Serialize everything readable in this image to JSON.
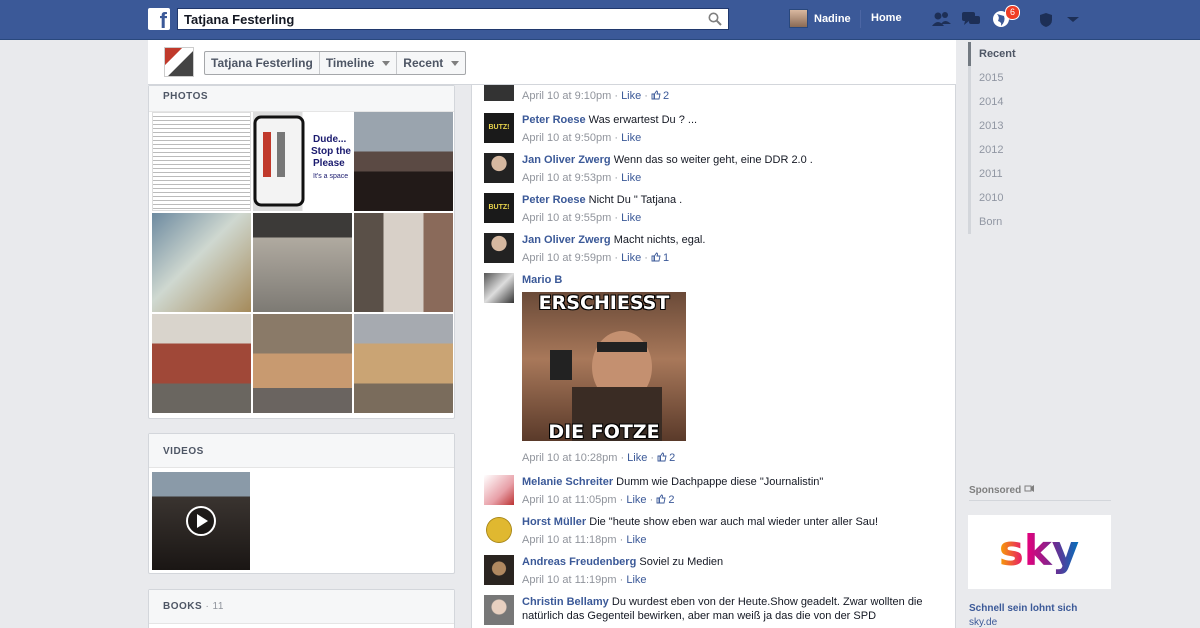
{
  "header": {
    "logo": "f",
    "search_value": "Tatjana Festerling",
    "user_name": "Nadine",
    "home_label": "Home",
    "notification_count": "6",
    "icons": [
      "friends-icon",
      "messages-icon",
      "globe-icon",
      "privacy-icon",
      "settings-caret-icon"
    ]
  },
  "timeline_nav": {
    "name_button": "Tatjana Festerling",
    "timeline_button": "Timeline",
    "recent_button": "Recent"
  },
  "photos": {
    "title": "PHOTOS",
    "count": 9
  },
  "videos": {
    "title": "VIDEOS",
    "play_icon": "play-icon"
  },
  "books": {
    "title": "BOOKS",
    "count": "· 11"
  },
  "comments": [
    {
      "name": "",
      "text": "",
      "time": "April 10 at 9:10pm",
      "like": "Like",
      "likes": "2"
    },
    {
      "name": "Peter Roese",
      "text": "Was erwartest Du ? ...",
      "time": "April 10 at 9:50pm",
      "like": "Like",
      "likes": ""
    },
    {
      "name": "Jan Oliver Zwerg",
      "text": "Wenn das so weiter geht, eine DDR 2.0 .",
      "time": "April 10 at 9:53pm",
      "like": "Like",
      "likes": ""
    },
    {
      "name": "Peter Roese",
      "text": "Nicht Du \" Tatjana .",
      "time": "April 10 at 9:55pm",
      "like": "Like",
      "likes": ""
    },
    {
      "name": "Jan Oliver Zwerg",
      "text": "Macht nichts, egal.",
      "time": "April 10 at 9:59pm",
      "like": "Like",
      "likes": "1"
    },
    {
      "name": "Mario B",
      "text": "",
      "time": "April 10 at 10:28pm",
      "like": "Like",
      "likes": "2",
      "meme_top": "ERSCHIESST",
      "meme_bottom": "DIE FOTZE"
    },
    {
      "name": "Melanie Schreiter",
      "text": "Dumm wie Dachpappe diese \"Journalistin\"",
      "time": "April 10 at 11:05pm",
      "like": "Like",
      "likes": "2"
    },
    {
      "name": "Horst Müller",
      "text": "Die \"heute show eben war auch mal wieder unter aller Sau!",
      "time": "April 10 at 11:18pm",
      "like": "Like",
      "likes": ""
    },
    {
      "name": "Andreas Freudenberg",
      "text": "Soviel zu Medien",
      "time": "April 10 at 11:19pm",
      "like": "Like",
      "likes": ""
    },
    {
      "name": "Christin Bellamy",
      "text": "Du wurdest eben von der Heute.Show geadelt. Zwar wollten die natürlich das Gegenteil bewirken, aber man weiß ja das die von der SPD",
      "time": "",
      "like": "",
      "likes": ""
    }
  ],
  "years": [
    "Recent",
    "2015",
    "2014",
    "2013",
    "2012",
    "2011",
    "2010",
    "Born"
  ],
  "sponsored": {
    "label": "Sponsored",
    "brand": "sky",
    "title": "Schnell sein lohnt sich",
    "url": "sky.de"
  }
}
